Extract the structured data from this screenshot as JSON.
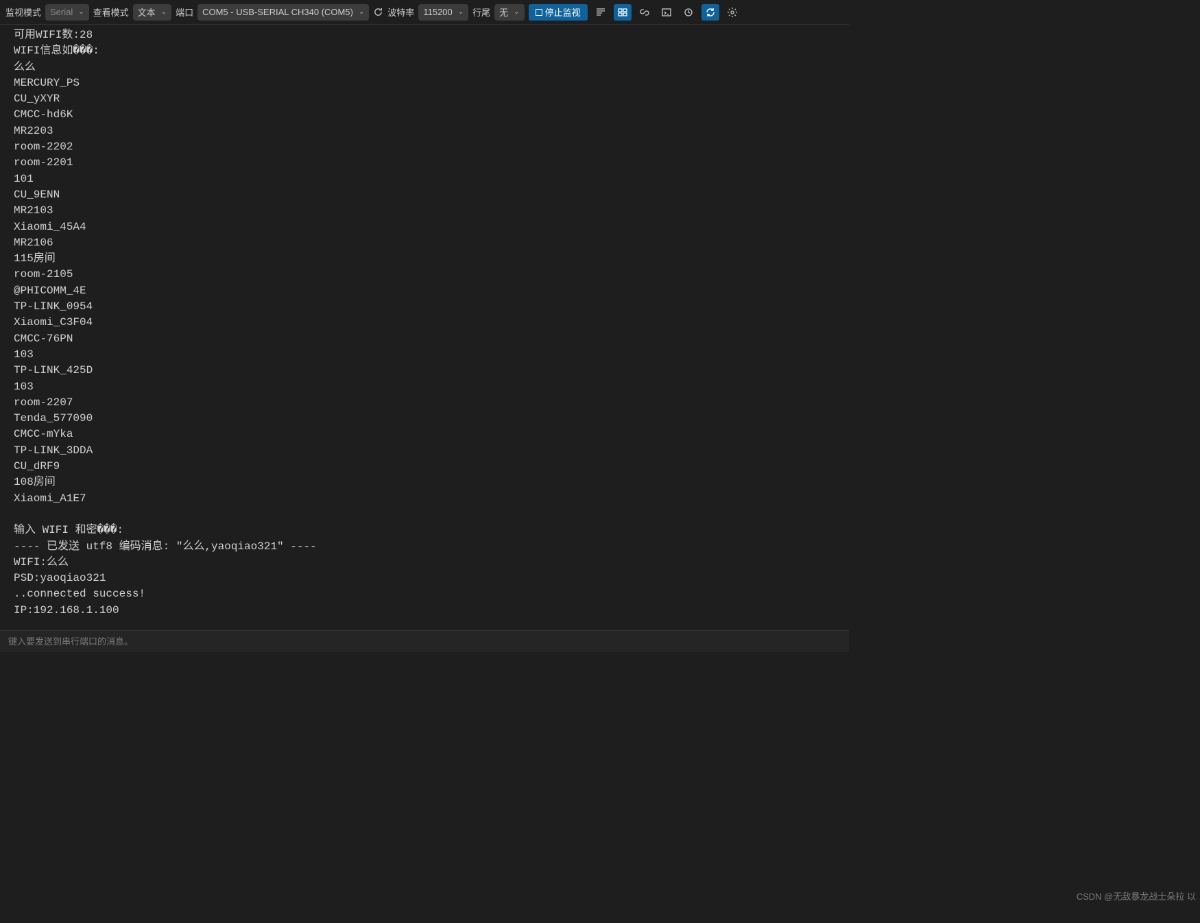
{
  "toolbar": {
    "monitor_mode_label": "监视模式",
    "monitor_mode_value": "Serial",
    "view_mode_label": "查看模式",
    "view_mode_value": "文本",
    "port_label": "端口",
    "port_value": "COM5 - USB-SERIAL CH340 (COM5)",
    "baud_label": "波特率",
    "baud_value": "115200",
    "line_end_label": "行尾",
    "line_end_value": "无",
    "stop_button": "停止监视"
  },
  "terminal_lines": [
    "可用WIFI数:28",
    "WIFI信息如���:",
    "么么",
    "MERCURY_PS",
    "CU_yXYR",
    "CMCC-hd6K",
    "MR2203",
    "room-2202",
    "room-2201",
    "101",
    "CU_9ENN",
    "MR2103",
    "Xiaomi_45A4",
    "MR2106",
    "115房间",
    "room-2105",
    "@PHICOMM_4E",
    "TP-LINK_0954",
    "Xiaomi_C3F04",
    "CMCC-76PN",
    "103",
    "TP-LINK_425D",
    "103",
    "room-2207",
    "Tenda_577090",
    "CMCC-mYka",
    "TP-LINK_3DDA",
    "CU_dRF9",
    "108房间",
    "Xiaomi_A1E7",
    "",
    "输入 WIFI 和密���:",
    "---- 已发送 utf8 编码消息: \"么么,yaoqiao321\" ----",
    "WIFI:么么",
    "PSD:yaoqiao321",
    "..connected success!",
    "IP:192.168.1.100"
  ],
  "input": {
    "placeholder": "键入要发送到串行端口的消息。"
  },
  "watermark": "CSDN @无敌暴龙战士朵拉 以"
}
